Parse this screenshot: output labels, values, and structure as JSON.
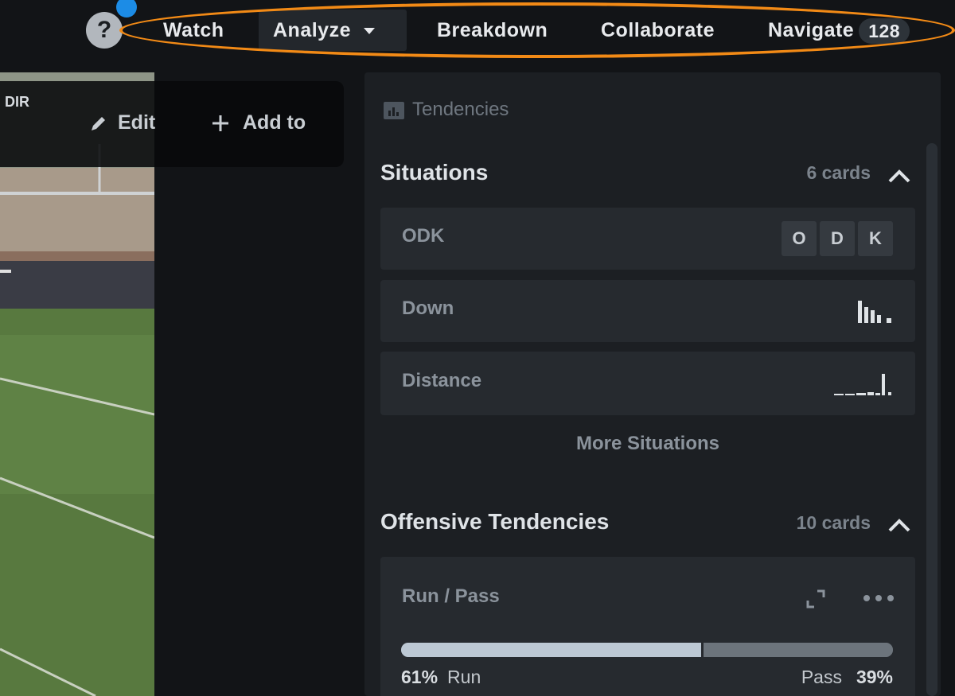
{
  "nav": {
    "help_icon": "question-mark-icon",
    "items": [
      {
        "label": "Watch"
      },
      {
        "label": "Analyze",
        "active": true
      },
      {
        "label": "Breakdown"
      },
      {
        "label": "Collaborate"
      },
      {
        "label": "Navigate",
        "badge": "128"
      }
    ]
  },
  "video_overlay": {
    "direction_label": "DIR",
    "edit_label": "Edit",
    "add_to_label": "Add to"
  },
  "tendencies": {
    "header": "Tendencies",
    "situations": {
      "title": "Situations",
      "count": "6 cards",
      "cards": {
        "odk": {
          "label": "ODK",
          "buttons": [
            "O",
            "D",
            "K"
          ]
        },
        "down": {
          "label": "Down"
        },
        "distance": {
          "label": "Distance"
        }
      },
      "more_label": "More Situations"
    },
    "offensive": {
      "title": "Offensive Tendencies",
      "count": "10 cards",
      "run_pass": {
        "label": "Run / Pass",
        "run_pct": "61%",
        "run_label": "Run",
        "pass_label": "Pass",
        "pass_pct": "39%",
        "run_fraction": 0.61
      }
    }
  },
  "colors": {
    "accent_ring": "#f28a16",
    "notification_dot": "#1c8ce6",
    "run_bar": "#bcc8d4",
    "pass_bar": "#6c747c"
  }
}
